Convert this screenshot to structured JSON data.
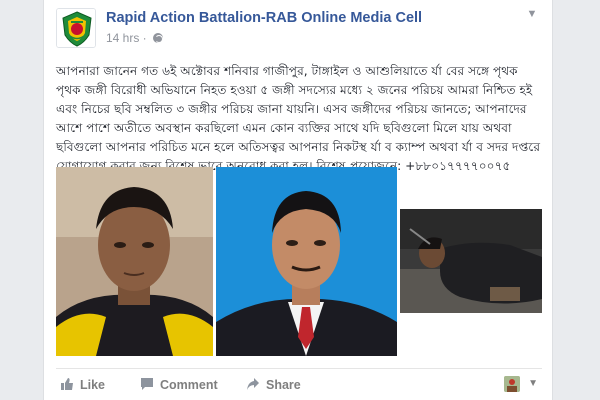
{
  "post": {
    "page_name": "Rapid Action Battalion-RAB Online Media Cell",
    "timestamp": "14 hrs · ",
    "text": "আপনারা জানেন গত ৬ই অক্টোবর শনিবার গাজীপুর, টাঙ্গাইল ও আশুলিয়াতে র্যা বের সঙ্গে পৃথক পৃথক জঙ্গী বিরোধী অভিযানে নিহত হওয়া ৫ জঙ্গী সদস্যের মধ্যে ২ জনের পরিচয় আমরা নিশ্চিত হই এবং নিচের ছবি সম্বলিত ৩ জঙ্গীর পরিচয় জানা যায়নি। এসব জঙ্গীদের পরিচয় জানতে; আপনাদের আশে পাশে অতীতে অবস্থান করছিলো এমন কোন ব্যক্তির সাথে যদি ছবিগুলো মিলে যায় অথবা ছবিগুলো আপনার পরিচিত মনে হলে অতিসত্বর আপনার নিকটস্থ র্যা ব ক্যাম্প অথবা র্যা ব সদর দপ্তরে যোগাযোগ করার জন্য বিশেষ ভাবে অনুরোধ করা হল। বিশেষ প্রয়োজনে: +৮৮০১৭৭৭৭০০৭৫"
  },
  "actions": {
    "like": "Like",
    "comment": "Comment",
    "share": "Share"
  },
  "icons": {
    "more": "chevron-down-icon",
    "privacy": "globe-icon",
    "like": "thumbs-up-icon",
    "comment": "speech-bubble-icon",
    "share": "share-arrow-icon"
  },
  "colors": {
    "page_name": "#365899",
    "meta": "#90949c",
    "action": "#7f7f7f",
    "background": "#e9ebee"
  }
}
